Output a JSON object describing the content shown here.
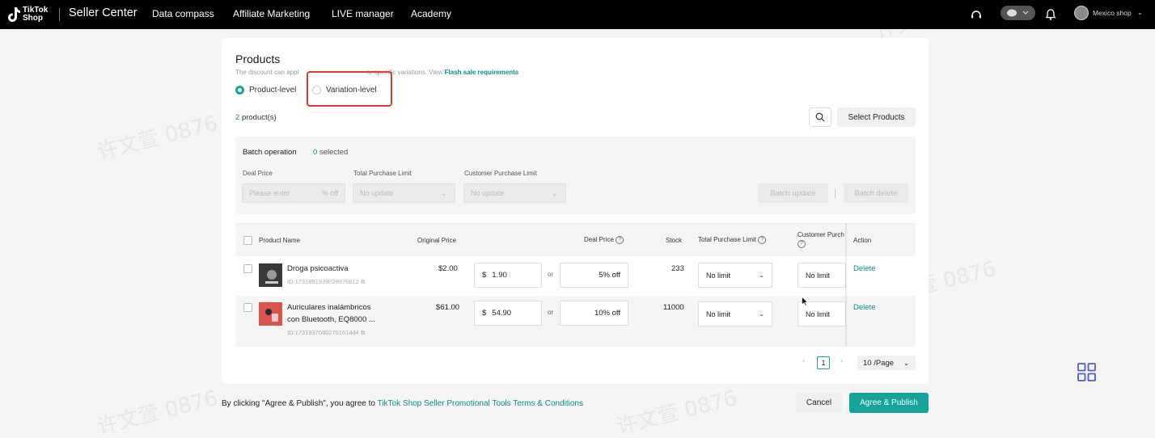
{
  "topbar": {
    "logo_text_line1": "TikTok",
    "logo_text_line2": "Shop",
    "app_name": "Seller Center",
    "nav": [
      "Data compass",
      "Affiliate Marketing",
      "LIVE manager",
      "Academy"
    ],
    "shop_name": "Mexico shop"
  },
  "products": {
    "title": "Products",
    "subtitle": "The discount can appl",
    "subtitle_middle": "or specific variations. View",
    "requirements_link": "Flash sale requirements",
    "radio_product_level": "Product-level",
    "radio_variation_level": "Variation-level",
    "count_number": "2",
    "count_label": "product(s)",
    "select_products": "Select Products"
  },
  "batch": {
    "title": "Batch operation",
    "selected_count": "0",
    "selected_label": "selected",
    "deal_price_label": "Deal Price",
    "deal_price_placeholder": "Please enter",
    "deal_price_suffix": "% off",
    "total_limit_label": "Total Purchase Limit",
    "total_limit_value": "No update",
    "customer_limit_label": "Customer Purchase Limit",
    "customer_limit_value": "No update",
    "batch_update": "Batch update",
    "batch_delete": "Batch delete"
  },
  "table": {
    "headers": {
      "product_name": "Product Name",
      "original_price": "Original Price",
      "deal_price": "Deal Price",
      "stock": "Stock",
      "total_purchase_limit": "Total Purchase Limit",
      "customer_purchase_limit": "Customer Purch",
      "action": "Action"
    },
    "rows": [
      {
        "name_line1": "Droga psicoactiva",
        "name_line2": "",
        "id": "ID:1731891939029976612",
        "original_price": "$2.00",
        "currency": "$",
        "deal_price": "1.90",
        "or": "or",
        "discount": "5% off",
        "stock": "233",
        "total_limit": "No limit",
        "customer_limit": "No limit",
        "action": "Delete"
      },
      {
        "name_line1": "Auriculares inalámbricos",
        "name_line2": "con Bluetooth, EQ8000 ...",
        "id": "ID:1731937080270161444",
        "original_price": "$61.00",
        "currency": "$",
        "deal_price": "54.90",
        "or": "or",
        "discount": "10% off",
        "stock": "11000",
        "total_limit": "No limit",
        "customer_limit": "No limit",
        "action": "Delete"
      }
    ]
  },
  "pagination": {
    "current_page": "1",
    "page_size": "10 /Page"
  },
  "footer": {
    "terms_prefix": "By clicking \"Agree & Publish\", you agree to",
    "terms_link": "TikTok Shop Seller Promotional Tools Terms & Conditions",
    "cancel": "Cancel",
    "publish": "Agree & Publish"
  },
  "watermark": "许文萱 0876",
  "colors": {
    "accent": "#16a39a",
    "link": "#0f8a86",
    "highlight_box": "#e53935",
    "topbar": "#000000"
  }
}
